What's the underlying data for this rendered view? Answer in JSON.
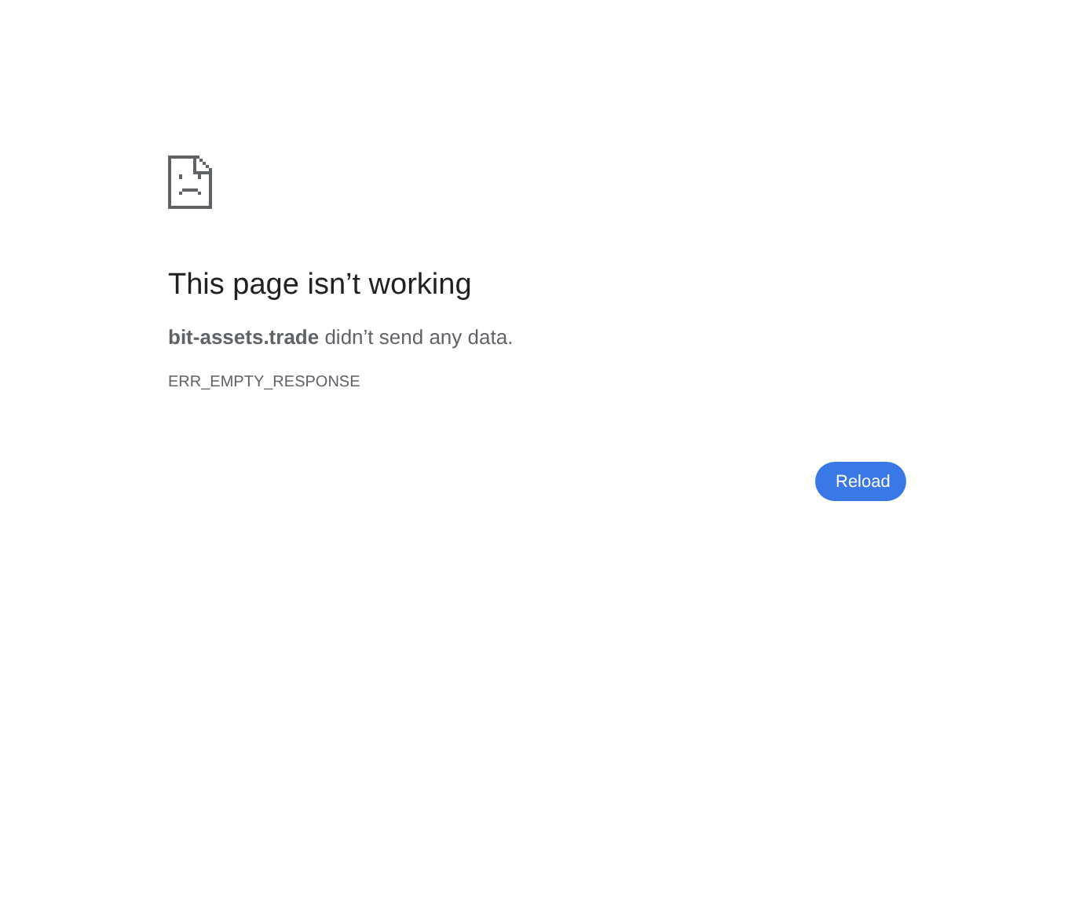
{
  "heading": "This page isn’t working",
  "message": "**bit-assets.trade** didn’t send any data.",
  "error_code": "ERR_EMPTY_RESPONSE",
  "buttons": [
    {
      "label": "Reload"
    }
  ]
}
